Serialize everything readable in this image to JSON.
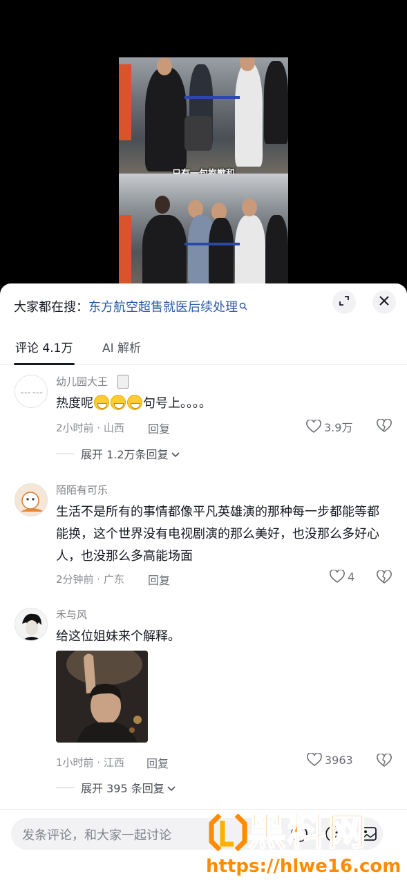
{
  "video": {
    "caption": "只有一句抱歉和"
  },
  "search": {
    "prefix": "大家都在搜：",
    "term": "东方航空超售就医后续处理"
  },
  "tabs": [
    {
      "label": "评论 4.1万"
    },
    {
      "label": "AI 解析"
    }
  ],
  "comments": [
    {
      "username": "幼儿园大王",
      "text_before_emoji": "热度呢",
      "text_after_emoji": "句号上。。。。",
      "meta": "2小时前 · 山西",
      "reply": "回复",
      "likes": "3.9万",
      "expand_label": "展开 1.2万条回复"
    },
    {
      "username": "陌陌有可乐",
      "text": "生活不是所有的事情都像平凡英雄演的那种每一步都能等都能换，这个世界没有电视剧演的那么美好，也没那么多好心人，也没那么多高能场面",
      "meta": "2分钟前 · 广东",
      "reply": "回复",
      "likes": "4"
    },
    {
      "username": "禾与风",
      "text": "给这位姐妹来个解释。",
      "meta": "1小时前 · 江西",
      "reply": "回复",
      "likes": "3963",
      "expand_label": "展开 395 条回复"
    }
  ],
  "input": {
    "placeholder": "发条评论，和大家一起讨论"
  },
  "watermark": {
    "brand": "黑料网",
    "url": "https://hlwe16.com"
  },
  "colors": {
    "accent_link": "#2a5ca8",
    "watermark_orange": "#ff8c00"
  }
}
